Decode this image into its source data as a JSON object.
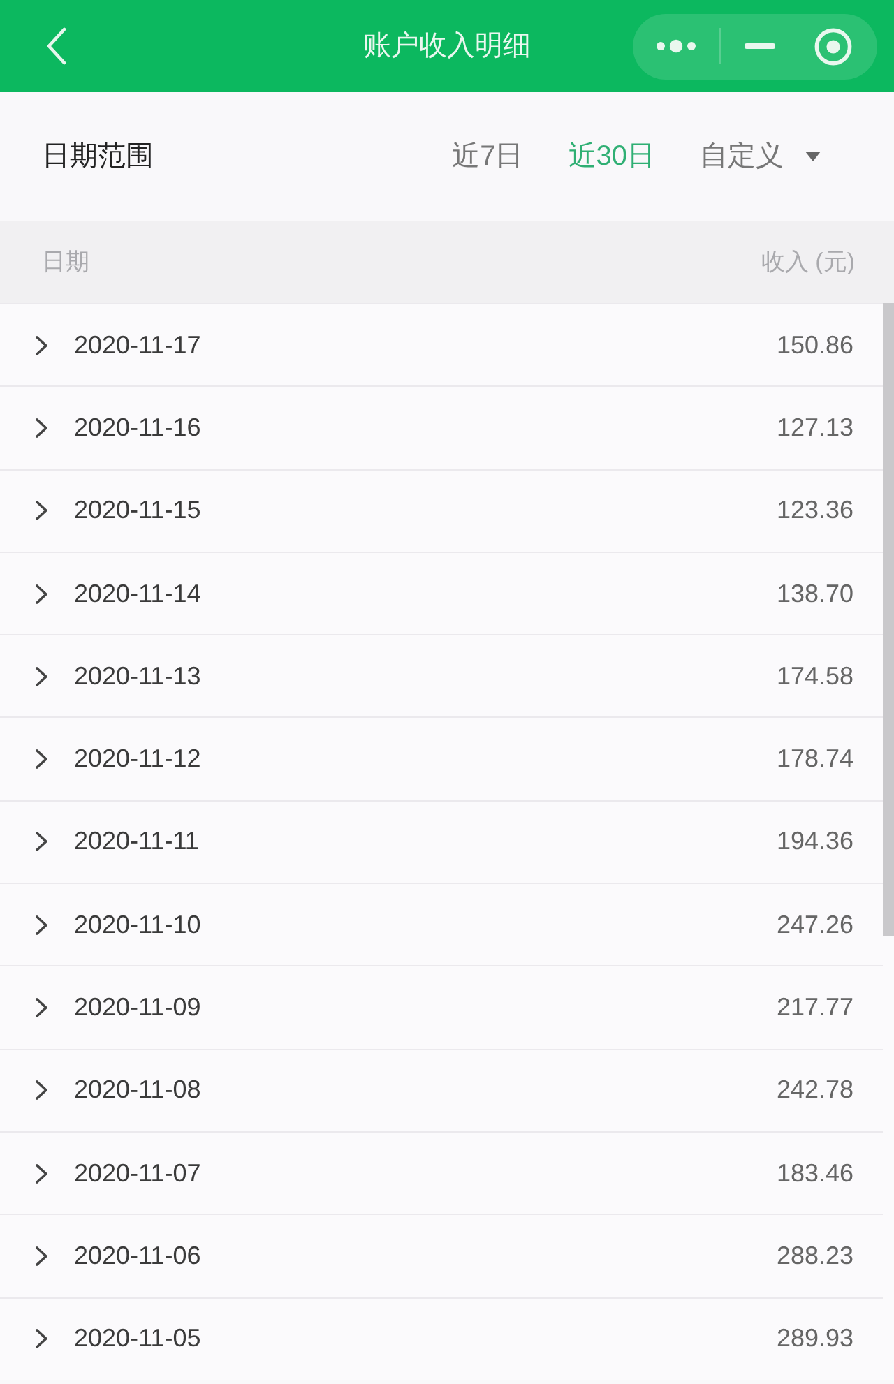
{
  "header": {
    "title": "账户收入明细"
  },
  "filter": {
    "label": "日期范围",
    "options": [
      {
        "label": "近7日",
        "selected": false,
        "kind": "preset"
      },
      {
        "label": "近30日",
        "selected": true,
        "kind": "preset"
      },
      {
        "label": "自定义",
        "selected": false,
        "kind": "dropdown"
      }
    ]
  },
  "table": {
    "columns": [
      "日期",
      "收入 (元)"
    ],
    "rows": [
      {
        "date": "2020-11-17",
        "amount": "150.86",
        "expanded": false
      },
      {
        "date": "2020-11-16",
        "amount": "127.13",
        "expanded": false
      },
      {
        "date": "2020-11-15",
        "amount": "123.36",
        "expanded": false
      },
      {
        "date": "2020-11-14",
        "amount": "138.70",
        "expanded": false
      },
      {
        "date": "2020-11-13",
        "amount": "174.58",
        "expanded": false
      },
      {
        "date": "2020-11-12",
        "amount": "178.74",
        "expanded": false
      },
      {
        "date": "2020-11-11",
        "amount": "194.36",
        "expanded": false
      },
      {
        "date": "2020-11-10",
        "amount": "247.26",
        "expanded": false
      },
      {
        "date": "2020-11-09",
        "amount": "217.77",
        "expanded": false
      },
      {
        "date": "2020-11-08",
        "amount": "242.78",
        "expanded": false
      },
      {
        "date": "2020-11-07",
        "amount": "183.46",
        "expanded": false
      },
      {
        "date": "2020-11-06",
        "amount": "288.23",
        "expanded": false
      },
      {
        "date": "2020-11-05",
        "amount": "289.93",
        "expanded": false
      }
    ]
  }
}
